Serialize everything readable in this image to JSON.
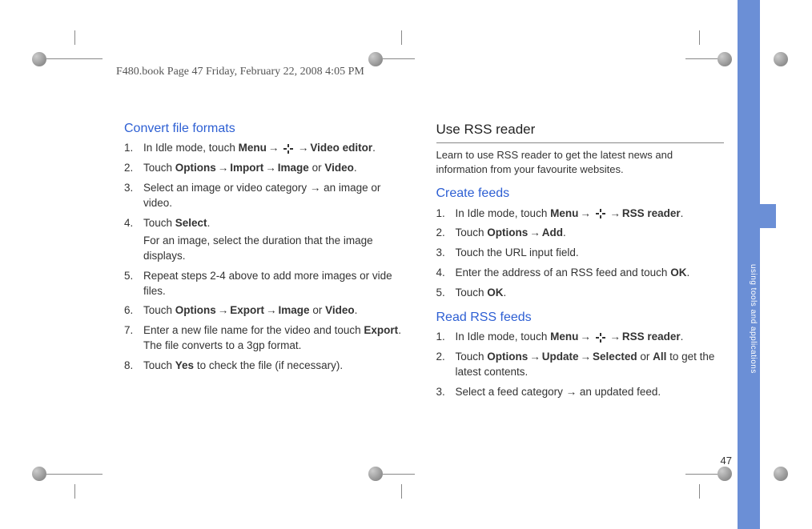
{
  "header": "F480.book  Page 47  Friday, February 22, 2008  4:05 PM",
  "sidebar_label": "using tools and applications",
  "page_number": "47",
  "arrow": "→",
  "left": {
    "h1": "Convert file formats",
    "s1a": "In Idle mode, touch ",
    "s1b": "Menu",
    "s1c": "Video editor",
    "s2a": "Touch ",
    "s2b": "Options",
    "s2c": "Import",
    "s2d": "Image",
    "s2e": " or ",
    "s2f": "Video",
    "s3": "Select an image or video category → an image or video.",
    "s4a": "Touch ",
    "s4b": "Select",
    "s4note": "For an image, select the duration that the image displays.",
    "s5": "Repeat steps 2-4 above to add more images or vide files.",
    "s6a": "Touch ",
    "s6b": "Options",
    "s6c": "Export",
    "s6d": "Image",
    "s6e": " or ",
    "s6f": "Video",
    "s7a": "Enter a new file name for the video and touch ",
    "s7b": "Export",
    "s7c": ". The file converts to a 3gp format.",
    "s8a": "Touch ",
    "s8b": "Yes",
    "s8c": " to check the file (if necessary)."
  },
  "right": {
    "h1": "Use RSS reader",
    "intro": "Learn to use RSS reader to get the latest news and information from your favourite websites.",
    "h2": "Create feeds",
    "c1a": "In Idle mode, touch ",
    "c1b": "Menu",
    "c1c": "RSS reader",
    "c2a": "Touch ",
    "c2b": "Options",
    "c2c": "Add",
    "c3": "Touch the URL input field.",
    "c4a": "Enter the address of an RSS feed and touch ",
    "c4b": "OK",
    "c5a": "Touch ",
    "c5b": "OK",
    "h3": "Read RSS feeds",
    "r1a": "In Idle mode, touch ",
    "r1b": "Menu",
    "r1c": "RSS reader",
    "r2a": "Touch ",
    "r2b": "Options",
    "r2c": "Update",
    "r2d": "Selected",
    "r2e": " or ",
    "r2f": "All",
    "r2g": " to get the latest contents.",
    "r3": "Select a feed category → an updated feed."
  }
}
